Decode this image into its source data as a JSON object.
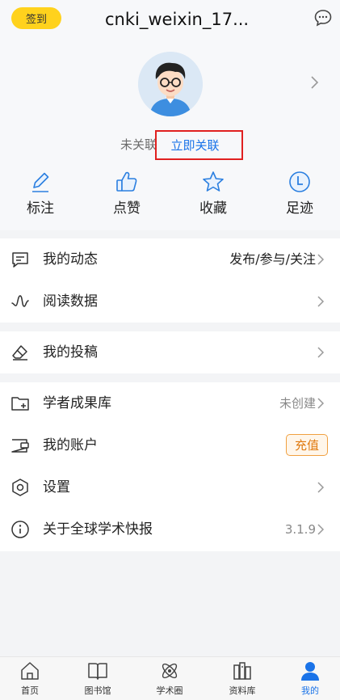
{
  "header": {
    "sign_in_label": "签到",
    "username": "cnki_weixin_17..."
  },
  "profile": {
    "link_status": "未关联",
    "link_now_label": "立即关联"
  },
  "quick_actions": [
    {
      "label": "标注",
      "icon": "pencil-icon"
    },
    {
      "label": "点赞",
      "icon": "thumbs-up-icon"
    },
    {
      "label": "收藏",
      "icon": "star-icon"
    },
    {
      "label": "足迹",
      "icon": "clock-icon"
    }
  ],
  "menu": {
    "activity": {
      "label": "我的动态",
      "value": "发布/参与/关注"
    },
    "reading": {
      "label": "阅读数据"
    },
    "submission": {
      "label": "我的投稿"
    },
    "scholar": {
      "label": "学者成果库",
      "value": "未创建"
    },
    "account": {
      "label": "我的账户",
      "action": "充值"
    },
    "settings": {
      "label": "设置"
    },
    "about": {
      "label": "关于全球学术快报",
      "value": "3.1.9"
    }
  },
  "tabbar": [
    {
      "label": "首页",
      "icon": "home-icon"
    },
    {
      "label": "图书馆",
      "icon": "book-icon"
    },
    {
      "label": "学术圈",
      "icon": "atom-icon"
    },
    {
      "label": "资料库",
      "icon": "library-icon"
    },
    {
      "label": "我的",
      "icon": "user-icon",
      "active": true
    }
  ],
  "colors": {
    "accent": "#1a73e8",
    "sign_in": "#ffd21d",
    "recharge": "#e07a10",
    "highlight_box": "#e02020"
  }
}
